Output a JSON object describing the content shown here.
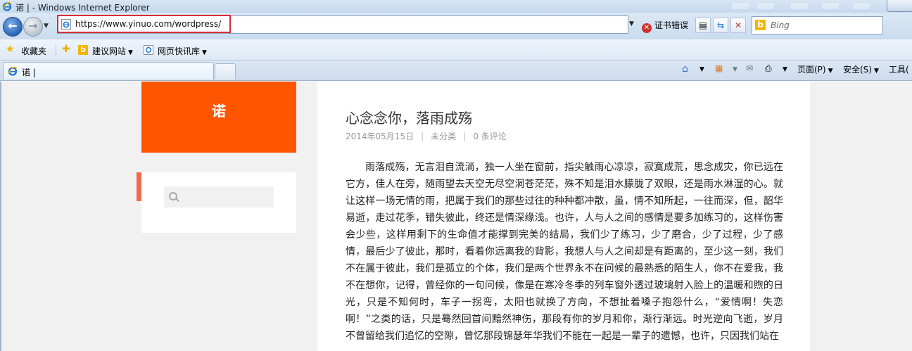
{
  "window": {
    "title": "诺 | - Windows Internet Explorer"
  },
  "navigation": {
    "url": "https://www.yinuo.com/wordpress/",
    "cert_error_label": "证书错误",
    "search_placeholder": "Bing"
  },
  "favorites_bar": {
    "favorites_label": "收藏夹",
    "items": [
      {
        "label": "建议网站"
      },
      {
        "label": "网页快讯库"
      }
    ]
  },
  "tabs": [
    {
      "title": "诺 |"
    }
  ],
  "command_bar": {
    "page_label": "页面(P)",
    "safety_label": "安全(S)",
    "tools_label": "工具("
  },
  "site": {
    "title": "诺",
    "accent_color": "#fe5600"
  },
  "post": {
    "title": "心念念你，落雨成殇",
    "date": "2014年05月15日",
    "category": "未分类",
    "comments": "0 条评论",
    "body": "雨落成殇，无言泪自流淌，独一人坐在窗前，指尖触雨心凉凉，寂寞成荒，思念成灾，你已远在它方，佳人在旁，随雨望去天空无尽空洞苍茫茫，殊不知是泪水朦胧了双眼，还是雨水淋湿的心。就让这样一场无情的雨，把属于我们的那些过往的种种都冲散，虽，情不知所起，一往而深，但，韶华易逝，走过花季，错失彼此，终还是情深缘浅。也许，人与人之间的感情是要多加练习的，这样伤害会少些，这样用剩下的生命值才能撑到完美的结局，我们少了练习，少了磨合，少了过程，少了感情，最后少了彼此，那时，看着你远离我的背影，我想人与人之间却是有距离的，至少这一刻，我们不在属于彼此，我们是孤立的个体，我们是两个世界永不在问候的最熟悉的陌生人，你不在爱我，我不在想你，记得，曾经你的一句问候，像是在寒冷冬季的列车窗外透过玻璃射入脸上的温暖和煦的日光，只是不知何时，车子一拐弯，太阳也就换了方向，不想扯着嗓子抱怨什么，“爱情啊！失恋啊！”之类的话，只是蓦然回首间黯然神伤，那段有你的岁月和你，渐行渐远。时光逆向飞逝，岁月不曾留给我们追忆的空隙，曾忆那段锦瑟年华我们不能在一起是一辈子的遗憾，也许，只因我们站在"
  }
}
